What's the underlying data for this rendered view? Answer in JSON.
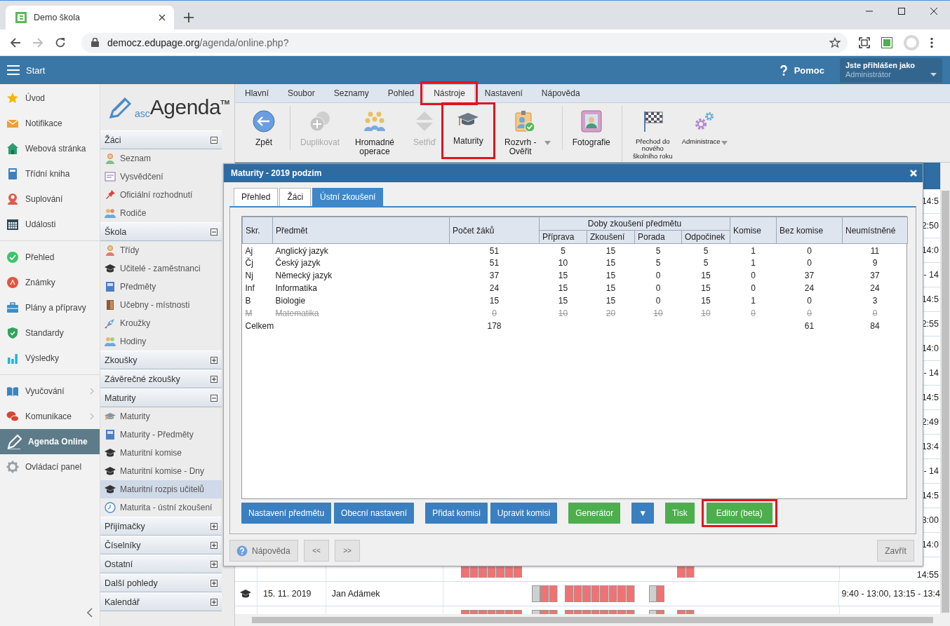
{
  "browser": {
    "tab_title": "Demo škola",
    "url_host": "democz.edupage.org",
    "url_path": "/agenda/online.php?"
  },
  "header": {
    "menu_label": "Start",
    "help": "Pomoc",
    "user_caption": "Jste přihlášen jako",
    "user_name": "Administrátor"
  },
  "nav": {
    "groups": [
      {
        "items": [
          {
            "label": "Úvod",
            "selected": false,
            "submenu": false
          },
          {
            "label": "Notifikace",
            "selected": false,
            "submenu": false
          },
          {
            "label": "Webová stránka",
            "selected": false,
            "submenu": false
          },
          {
            "label": "Třídní kniha",
            "selected": false,
            "submenu": false
          },
          {
            "label": "Suplování",
            "selected": false,
            "submenu": false
          },
          {
            "label": "Události",
            "selected": false,
            "submenu": false
          }
        ]
      },
      {
        "items": [
          {
            "label": "Přehled",
            "selected": false,
            "submenu": false
          },
          {
            "label": "Známky",
            "selected": false,
            "submenu": false
          },
          {
            "label": "Plány a přípravy",
            "selected": false,
            "submenu": false
          },
          {
            "label": "Standardy",
            "selected": false,
            "submenu": false
          },
          {
            "label": "Výsledky",
            "selected": false,
            "submenu": false
          }
        ]
      },
      {
        "items": [
          {
            "label": "Vyučování",
            "selected": false,
            "submenu": true
          },
          {
            "label": "Komunikace",
            "selected": false,
            "submenu": true
          },
          {
            "label": "Agenda Online",
            "selected": true,
            "submenu": false
          },
          {
            "label": "Ovládací panel",
            "selected": false,
            "submenu": false
          }
        ]
      }
    ]
  },
  "sidebar": {
    "logo": {
      "prefix": "asc",
      "name": "Agenda",
      "mark": "TM"
    },
    "sections": [
      {
        "title": "Žáci",
        "expanded": true,
        "items": [
          {
            "label": "Seznam",
            "selected": false
          },
          {
            "label": "Vysvědčení",
            "selected": false
          },
          {
            "label": "Oficiální rozhodnutí",
            "selected": false
          },
          {
            "label": "Rodiče",
            "selected": false
          }
        ]
      },
      {
        "title": "Škola",
        "expanded": true,
        "items": [
          {
            "label": "Třídy",
            "selected": false
          },
          {
            "label": "Učitelé - zaměstnanci",
            "selected": false
          },
          {
            "label": "Předměty",
            "selected": false
          },
          {
            "label": "Učebny - místnosti",
            "selected": false
          },
          {
            "label": "Kroužky",
            "selected": false
          },
          {
            "label": "Hodiny",
            "selected": false
          }
        ]
      },
      {
        "title": "Zkoušky",
        "expanded": false
      },
      {
        "title": "Závěrečné zkoušky",
        "expanded": false
      },
      {
        "title": "Maturity",
        "expanded": true,
        "items": [
          {
            "label": "Maturity",
            "selected": false
          },
          {
            "label": "Maturity - Předměty",
            "selected": false
          },
          {
            "label": "Maturitní komise",
            "selected": false
          },
          {
            "label": "Maturitní komise - Dny",
            "selected": false
          },
          {
            "label": "Maturitní rozpis učitelů",
            "selected": true
          },
          {
            "label": "Maturita - ústní zkoušení",
            "selected": false
          }
        ]
      },
      {
        "title": "Přijímačky",
        "expanded": false
      },
      {
        "title": "Číselníky",
        "expanded": false
      },
      {
        "title": "Ostatní",
        "expanded": false
      },
      {
        "title": "Další pohledy",
        "expanded": false
      },
      {
        "title": "Kalendář",
        "expanded": false
      }
    ]
  },
  "ribbon": {
    "tabs": [
      {
        "label": "Hlavní",
        "selected": false,
        "highlighted": false
      },
      {
        "label": "Soubor",
        "selected": false,
        "highlighted": false
      },
      {
        "label": "Seznamy",
        "selected": false,
        "highlighted": false
      },
      {
        "label": "Pohled",
        "selected": false,
        "highlighted": false
      },
      {
        "label": "Nástroje",
        "selected": true,
        "highlighted": true
      },
      {
        "label": "Nastavení",
        "selected": false,
        "highlighted": false
      },
      {
        "label": "Nápověda",
        "selected": false,
        "highlighted": false
      }
    ],
    "tools": [
      {
        "label": "Zpět",
        "kind": "large",
        "disabled": false,
        "dropdown": false,
        "highlighted": false,
        "separator_before": false
      },
      {
        "label": "Duplikovat",
        "kind": "large",
        "disabled": true,
        "dropdown": false,
        "highlighted": false,
        "separator_before": true
      },
      {
        "label": "Hromadné operace",
        "kind": "large",
        "disabled": false,
        "dropdown": false,
        "highlighted": false,
        "separator_before": false
      },
      {
        "label": "Setřiď",
        "kind": "large",
        "disabled": true,
        "dropdown": false,
        "highlighted": false,
        "separator_before": false
      },
      {
        "label": "Maturity",
        "kind": "large",
        "disabled": false,
        "dropdown": false,
        "highlighted": true,
        "separator_before": false
      },
      {
        "label": "Rozvrh - Ověřit",
        "kind": "large",
        "disabled": false,
        "dropdown": true,
        "highlighted": false,
        "separator_before": false
      },
      {
        "label": "Fotografie",
        "kind": "large",
        "disabled": false,
        "dropdown": false,
        "highlighted": false,
        "separator_before": true
      },
      {
        "label": "Přechod do nového školního roku",
        "kind": "small",
        "disabled": false,
        "dropdown": false,
        "highlighted": false,
        "separator_before": true
      },
      {
        "label": "Administrace",
        "kind": "small",
        "disabled": false,
        "dropdown": true,
        "highlighted": false,
        "separator_before": false
      }
    ]
  },
  "schedule": {
    "rows": [
      {
        "kind": "edge",
        "time": "14:5"
      },
      {
        "kind": "edge",
        "time": "2:50"
      },
      {
        "kind": "edge",
        "time": "14:0"
      },
      {
        "kind": "edge",
        "time": "- 14"
      },
      {
        "kind": "edge",
        "time": "14:5"
      },
      {
        "kind": "edge",
        "time": "2:55"
      },
      {
        "kind": "edge",
        "time": "14:0"
      },
      {
        "kind": "edge",
        "time": "- 14"
      },
      {
        "kind": "edge",
        "time": "14:5"
      },
      {
        "kind": "edge",
        "time": "2:49"
      },
      {
        "kind": "edge",
        "time": "13:4"
      },
      {
        "kind": "edge",
        "time": "- 14"
      },
      {
        "kind": "edge",
        "time": "14:5"
      },
      {
        "kind": "edge",
        "time": "3:00"
      },
      {
        "kind": "edge",
        "time": "14:0"
      },
      {
        "kind": "lower",
        "time": "14:55"
      },
      {
        "kind": "full",
        "date": "15. 11. 2019",
        "teacher": "Jan Adámek",
        "time": "9:40 - 13:00, 13:15 - 13:4"
      },
      {
        "kind": "cut"
      }
    ]
  },
  "dialog": {
    "title": "Maturity - 2019 podzim",
    "tabs": [
      {
        "label": "Přehled",
        "selected": false
      },
      {
        "label": "Žáci",
        "selected": false
      },
      {
        "label": "Ústní zkoušení",
        "selected": true
      }
    ],
    "table": {
      "columns": [
        "Skr.",
        "Předmět",
        "Počet žáků"
      ],
      "group": {
        "title": "Doby zkoušení předmětu",
        "columns": [
          "Příprava",
          "Zkoušení",
          "Porada",
          "Odpočinek"
        ]
      },
      "columns_after": [
        "Komise",
        "Bez komise",
        "Neumístněné"
      ],
      "rows": [
        {
          "struck": false,
          "cells": [
            "Aj",
            "Anglický jazyk",
            "51",
            "5",
            "15",
            "5",
            "5",
            "1",
            "0",
            "11"
          ]
        },
        {
          "struck": false,
          "cells": [
            "Čj",
            "Český jazyk",
            "51",
            "10",
            "15",
            "5",
            "5",
            "1",
            "0",
            "9"
          ]
        },
        {
          "struck": false,
          "cells": [
            "Nj",
            "Německý jazyk",
            "37",
            "15",
            "15",
            "0",
            "15",
            "0",
            "37",
            "37"
          ]
        },
        {
          "struck": false,
          "cells": [
            "Inf",
            "Informatika",
            "24",
            "15",
            "15",
            "0",
            "15",
            "0",
            "24",
            "24"
          ]
        },
        {
          "struck": false,
          "cells": [
            "B",
            "Biologie",
            "15",
            "15",
            "15",
            "0",
            "15",
            "1",
            "0",
            "3"
          ]
        },
        {
          "struck": true,
          "cells": [
            "M",
            "Matematika",
            "0",
            "10",
            "20",
            "10",
            "10",
            "0",
            "0",
            "0"
          ]
        }
      ],
      "total": {
        "label": "Celkem",
        "students": "178",
        "without_committee": "61",
        "unplaced": "84"
      }
    },
    "button_groups": [
      {
        "buttons": [
          {
            "label": "Nastavení předmětu",
            "color": "#3a7fc0",
            "highlighted": false
          },
          {
            "label": "Obecní nastavení",
            "color": "#3a7fc0",
            "highlighted": false
          }
        ]
      },
      {
        "buttons": [
          {
            "label": "Přidat komisi",
            "color": "#3a7fc0",
            "highlighted": false
          },
          {
            "label": "Upravit komisi",
            "color": "#3a7fc0",
            "highlighted": false
          }
        ]
      },
      {
        "buttons": [
          {
            "label": "Generátor",
            "color": "#4cae4c",
            "highlighted": false
          }
        ]
      },
      {
        "buttons": [
          {
            "label": "▼",
            "color": "#3a7fc0",
            "highlighted": false
          }
        ]
      },
      {
        "buttons": [
          {
            "label": "Tisk",
            "color": "#4cae4c",
            "highlighted": false
          },
          {
            "label": "Editor (beta)",
            "color": "#4cae4c",
            "highlighted": true
          }
        ]
      }
    ],
    "footer": {
      "help": "Nápověda",
      "prev": "<<",
      "next": ">>",
      "close": "Zavřít"
    }
  }
}
